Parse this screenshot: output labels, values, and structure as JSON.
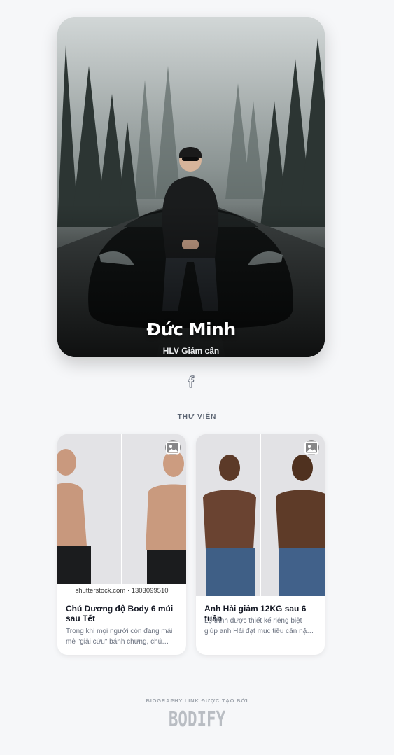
{
  "profile": {
    "name": "Đức Minh",
    "title": "HLV Giảm cân"
  },
  "social": {
    "icon": "facebook-icon"
  },
  "gallery": {
    "heading": "THƯ VIỆN",
    "items": [
      {
        "title": "Chú Dương độ Body 6 múi sau Tết",
        "description": "Trong khi mọi người còn đang mải mê \"giải cứu\" bánh chưng, chú Dương đ...",
        "image_caption": "shutterstock.com · 1303099510",
        "badge_icon": "image-icon"
      },
      {
        "title": "Anh Hải giảm 12KG sau 6 tuần",
        "description": "Lộ trình được thiết kế riêng biệt giúp anh Hải đạt mục tiêu cân nặng mà vẫ...",
        "badge_icon": "image-icon"
      }
    ]
  },
  "footer": {
    "label": "BIOGRAPHY LINK ĐƯỢC TẠO BỞI",
    "brand": "BODIFY"
  },
  "colors": {
    "background": "#f6f7f9",
    "card": "#ffffff",
    "accent_text": "#141824"
  }
}
